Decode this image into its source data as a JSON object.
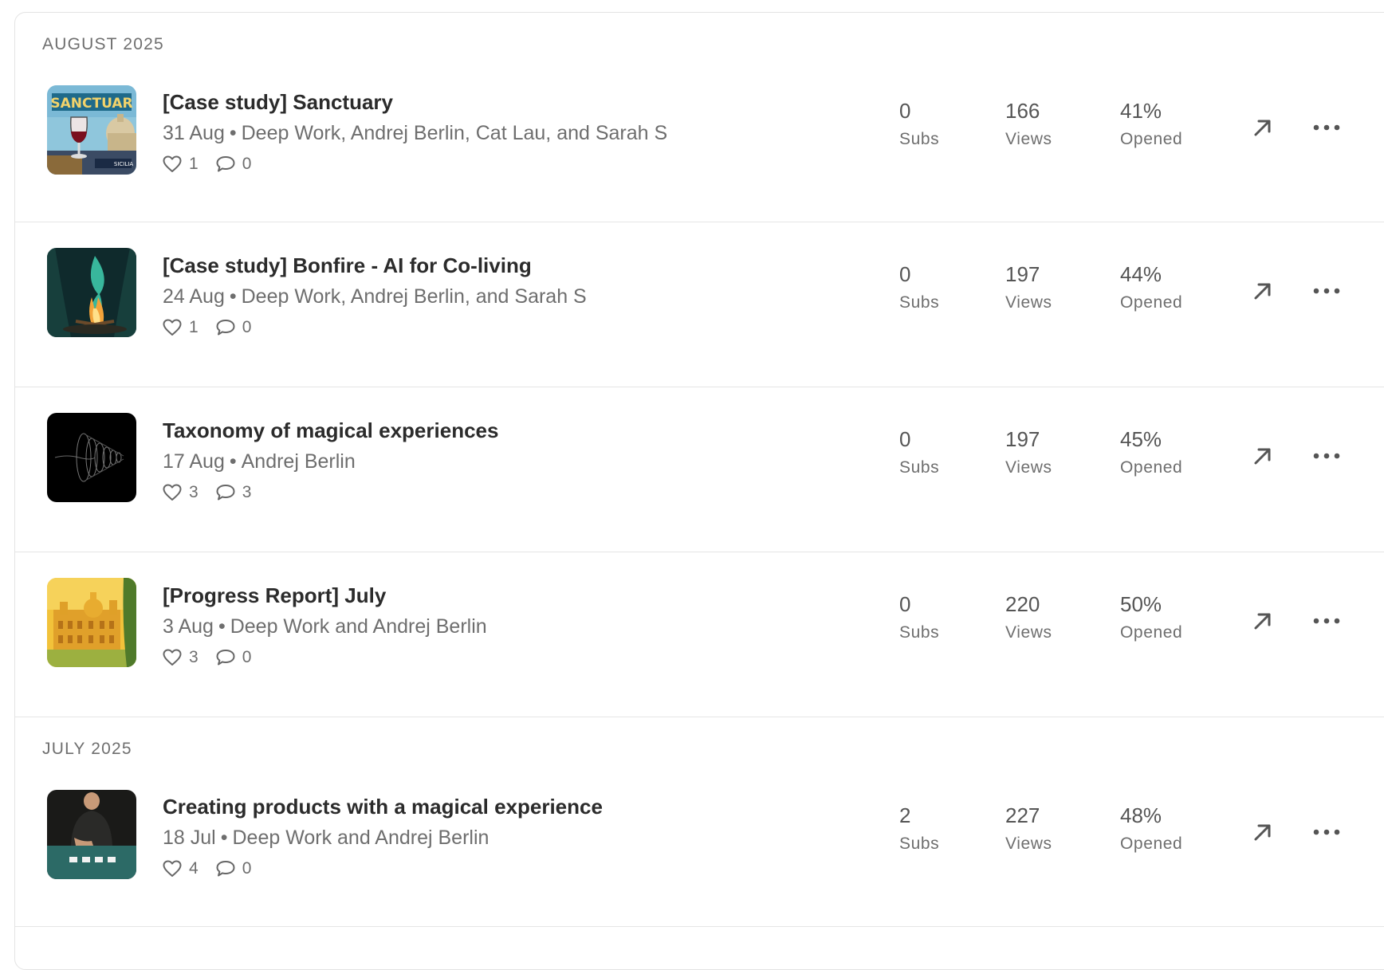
{
  "sections": [
    {
      "label": "AUGUST 2025",
      "posts": [
        {
          "title": "[Case study] Sanctuary",
          "date": "31 Aug",
          "authors": "Deep Work, Andrej Berlin, Cat Lau, and Sarah S",
          "likes": "1",
          "comments": "0",
          "subs": "0",
          "views": "166",
          "opened": "41%",
          "thumb_text": "SANCTUAR",
          "thumb_caption": "SICILIA"
        },
        {
          "title": "[Case study] Bonfire - AI for Co-living",
          "date": "24 Aug",
          "authors": "Deep Work, Andrej Berlin, and Sarah S",
          "likes": "1",
          "comments": "0",
          "subs": "0",
          "views": "197",
          "opened": "44%"
        },
        {
          "title": "Taxonomy of magical experiences",
          "date": "17 Aug",
          "authors": "Andrej Berlin",
          "likes": "3",
          "comments": "3",
          "subs": "0",
          "views": "197",
          "opened": "45%"
        },
        {
          "title": "[Progress Report] July",
          "date": "3 Aug",
          "authors": "Deep Work and Andrej Berlin",
          "likes": "3",
          "comments": "0",
          "subs": "0",
          "views": "220",
          "opened": "50%"
        }
      ]
    },
    {
      "label": "JULY 2025",
      "posts": [
        {
          "title": "Creating products with a magical experience",
          "date": "18 Jul",
          "authors": "Deep Work and Andrej Berlin",
          "likes": "4",
          "comments": "0",
          "subs": "2",
          "views": "227",
          "opened": "48%"
        }
      ]
    }
  ],
  "labels": {
    "separator": "•",
    "subs": "Subs",
    "views": "Views",
    "opened": "Opened"
  },
  "icons": {
    "like": "heart-icon",
    "comment": "comment-bubble-icon",
    "open": "arrow-up-right-icon",
    "more": "more-horizontal-icon"
  },
  "colors": {
    "text_primary": "#2b2b2b",
    "text_secondary": "#6e6e6e",
    "divider": "#e5e5e5"
  }
}
